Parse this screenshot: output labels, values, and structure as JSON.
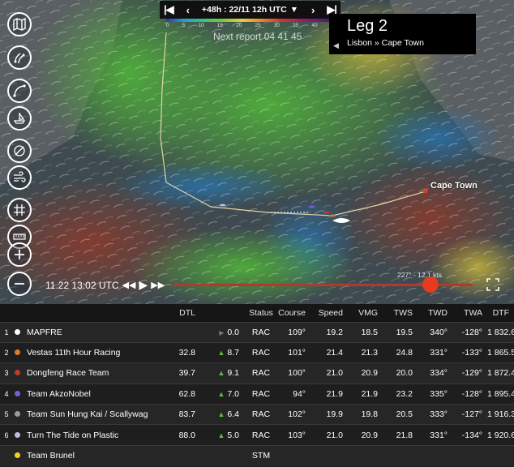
{
  "map": {
    "timebar": {
      "first_icon": "skip-first-icon",
      "prev_icon": "previous-icon",
      "label": "+48h : 22/11 12h UTC",
      "dropdown_icon": "caret-down-icon",
      "next_icon": "next-icon",
      "last_icon": "skip-last-icon"
    },
    "scale_ticks": [
      "0",
      "5",
      "10",
      "15",
      "20",
      "25",
      "30",
      "35",
      "40",
      "45"
    ],
    "next_report": "Next report 04 41 45",
    "leg": {
      "title": "Leg 2",
      "route": "Lisbon » Cape Town"
    },
    "destination": "Cape Town",
    "playback": {
      "time": "11.22 13:02 UTC"
    },
    "wind_readout": "227° - 12.1 kts",
    "tools": [
      "map-icon",
      "layers-icon",
      "route-icon",
      "ship-icon",
      "compass-icon",
      "wind-icon",
      "grid-icon",
      "ruler-icon",
      "zoom-in-icon",
      "zoom-out-icon"
    ]
  },
  "leaderboard": {
    "columns": {
      "dtl": "DTL",
      "status": "Status",
      "course": "Course",
      "speed": "Speed",
      "vmg": "VMG",
      "tws": "TWS",
      "twd": "TWD",
      "twa": "TWA",
      "dtf": "DTF"
    },
    "rows": [
      {
        "pos": "1",
        "color": "#ffffff",
        "team": "MAPFRE",
        "dtl": "",
        "trend": "flat",
        "delta": "0.0",
        "status": "RAC",
        "course": "109°",
        "speed": "19.2",
        "vmg": "18.5",
        "tws": "19.5",
        "twd": "340°",
        "twa": "-128°",
        "dtf": "1 832.60"
      },
      {
        "pos": "2",
        "color": "#e07b2a",
        "team": "Vestas 11th Hour Racing",
        "dtl": "32.8",
        "trend": "up",
        "delta": "8.7",
        "status": "RAC",
        "course": "101°",
        "speed": "21.4",
        "vmg": "21.3",
        "tws": "24.8",
        "twd": "331°",
        "twa": "-133°",
        "dtf": "1 865.50"
      },
      {
        "pos": "3",
        "color": "#c0392b",
        "team": "Dongfeng Race Team",
        "dtl": "39.7",
        "trend": "up",
        "delta": "9.1",
        "status": "RAC",
        "course": "100°",
        "speed": "21.0",
        "vmg": "20.9",
        "tws": "20.0",
        "twd": "334°",
        "twa": "-129°",
        "dtf": "1 872.40"
      },
      {
        "pos": "4",
        "color": "#7d5bd6",
        "team": "Team AkzoNobel",
        "dtl": "62.8",
        "trend": "up",
        "delta": "7.0",
        "status": "RAC",
        "course": "94°",
        "speed": "21.9",
        "vmg": "21.9",
        "tws": "23.2",
        "twd": "335°",
        "twa": "-128°",
        "dtf": "1 895.40"
      },
      {
        "pos": "5",
        "color": "#9a9a9a",
        "team": "Team Sun Hung Kai / Scallywag",
        "dtl": "83.7",
        "trend": "up",
        "delta": "6.4",
        "status": "RAC",
        "course": "102°",
        "speed": "19.9",
        "vmg": "19.8",
        "tws": "20.5",
        "twd": "333°",
        "twa": "-127°",
        "dtf": "1 916.30"
      },
      {
        "pos": "6",
        "color": "#c6b7e6",
        "team": "Turn The Tide on Plastic",
        "dtl": "88.0",
        "trend": "up",
        "delta": "5.0",
        "status": "RAC",
        "course": "103°",
        "speed": "21.0",
        "vmg": "20.9",
        "tws": "21.8",
        "twd": "331°",
        "twa": "-134°",
        "dtf": "1 920.60"
      },
      {
        "pos": "",
        "color": "#f0d020",
        "team": "Team Brunel",
        "dtl": "",
        "trend": "",
        "delta": "",
        "status": "STM",
        "course": "",
        "speed": "",
        "vmg": "",
        "tws": "",
        "twd": "",
        "twa": "",
        "dtf": ""
      }
    ]
  }
}
